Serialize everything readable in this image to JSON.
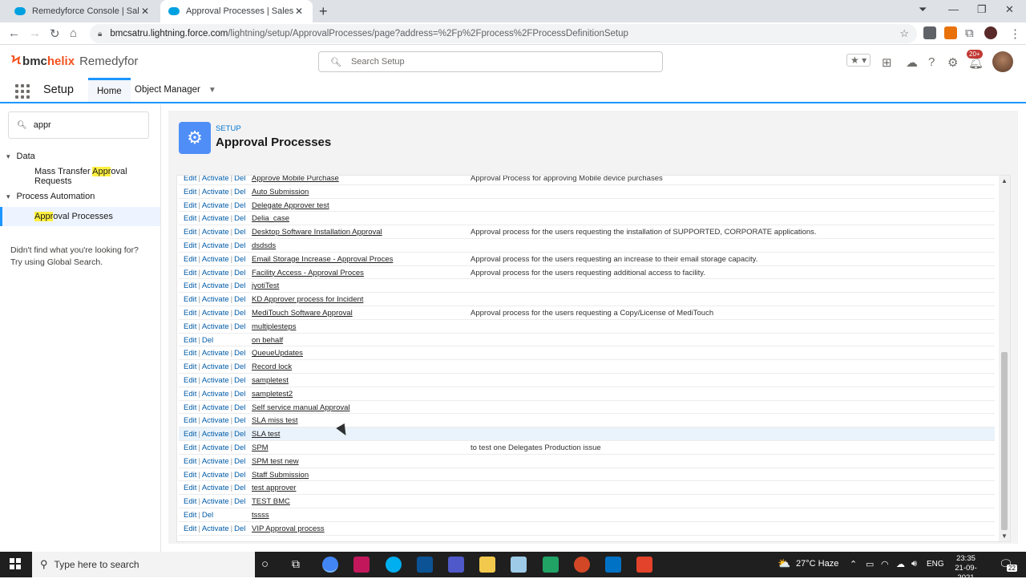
{
  "browser": {
    "tabs": [
      {
        "title": "Remedyforce Console | Salesforce",
        "active": false
      },
      {
        "title": "Approval Processes | Salesforce",
        "active": true
      }
    ],
    "url_host": "bmcsatru.lightning.force.com",
    "url_path": "/lightning/setup/ApprovalProcesses/page?address=%2Fp%2Fprocess%2FProcessDefinitionSetup"
  },
  "header": {
    "logo_bmc": "bmc",
    "logo_helix": "helix",
    "logo_product": "Remedyfor",
    "search_placeholder": "Search Setup",
    "notif_badge": "20+"
  },
  "nav": {
    "app_name": "Setup",
    "tabs": [
      {
        "label": "Home"
      },
      {
        "label": "Object Manager"
      }
    ]
  },
  "sidebar": {
    "quickfind_value": "appr",
    "groups": [
      {
        "label": "Data",
        "items": [
          {
            "label_pre": "Mass Transfer ",
            "label_hl": "Appr",
            "label_post": "oval Requests"
          }
        ]
      },
      {
        "label": "Process Automation",
        "items": [
          {
            "label_pre": "",
            "label_hl": "Appr",
            "label_post": "oval Processes"
          }
        ]
      }
    ],
    "not_found_1": "Didn't find what you're looking for?",
    "not_found_2": "Try using Global Search."
  },
  "page": {
    "eyebrow": "SETUP",
    "title": "Approval Processes"
  },
  "actions": {
    "edit": "Edit",
    "activate": "Activate",
    "del": "Del",
    "sep": "|"
  },
  "rows": [
    {
      "name": "Approve Mobile Purchase",
      "activate": true,
      "desc": "Approval Process for approving Mobile device purchases"
    },
    {
      "name": "Auto Submission",
      "activate": true,
      "desc": ""
    },
    {
      "name": "Delegate Approver test",
      "activate": true,
      "desc": ""
    },
    {
      "name": "Delia_case",
      "activate": true,
      "desc": ""
    },
    {
      "name": "Desktop Software Installation Approval",
      "activate": true,
      "desc": "Approval process for the users requesting the installation of SUPPORTED, CORPORATE applications."
    },
    {
      "name": "dsdsds",
      "activate": true,
      "desc": ""
    },
    {
      "name": "Email Storage Increase - Approval Proces",
      "activate": true,
      "desc": "Approval process for the users requesting an increase to their email storage capacity."
    },
    {
      "name": "Facility Access - Approval Proces",
      "activate": true,
      "desc": "Approval process for the users requesting additional access to facility."
    },
    {
      "name": "jyotiTest",
      "activate": true,
      "desc": ""
    },
    {
      "name": "KD Approver process for Incident",
      "activate": true,
      "desc": ""
    },
    {
      "name": "MediTouch Software Approval",
      "activate": true,
      "desc": "Approval process for the users requesting a Copy/License of MediTouch"
    },
    {
      "name": "multiplesteps",
      "activate": true,
      "desc": ""
    },
    {
      "name": "on behalf",
      "activate": false,
      "desc": ""
    },
    {
      "name": "QueueUpdates",
      "activate": true,
      "desc": ""
    },
    {
      "name": "Record lock",
      "activate": true,
      "desc": ""
    },
    {
      "name": "sampletest",
      "activate": true,
      "desc": ""
    },
    {
      "name": "sampletest2",
      "activate": true,
      "desc": ""
    },
    {
      "name": "Self service manual Approval",
      "activate": true,
      "desc": ""
    },
    {
      "name": "SLA miss test",
      "activate": true,
      "desc": ""
    },
    {
      "name": "SLA test",
      "activate": true,
      "desc": "",
      "hover": true
    },
    {
      "name": "SPM",
      "activate": true,
      "desc": "to test one Delegates Production issue"
    },
    {
      "name": "SPM test new",
      "activate": true,
      "desc": ""
    },
    {
      "name": "Staff Submission",
      "activate": true,
      "desc": ""
    },
    {
      "name": "test approver",
      "activate": true,
      "desc": ""
    },
    {
      "name": "TEST BMC",
      "activate": true,
      "desc": ""
    },
    {
      "name": "tssss",
      "activate": false,
      "desc": ""
    },
    {
      "name": "VIP Approval process",
      "activate": true,
      "desc": ""
    }
  ],
  "taskbar": {
    "search_placeholder": "Type here to search",
    "weather": "27°C  Haze",
    "lang": "ENG",
    "time": "23:35",
    "date": "21-09-2021",
    "notif_count": "22"
  },
  "colors": {
    "accent": "#1b96ff",
    "link": "#015ba7",
    "highlight": "#fff03f",
    "setup_icon": "#4f8ef7"
  }
}
